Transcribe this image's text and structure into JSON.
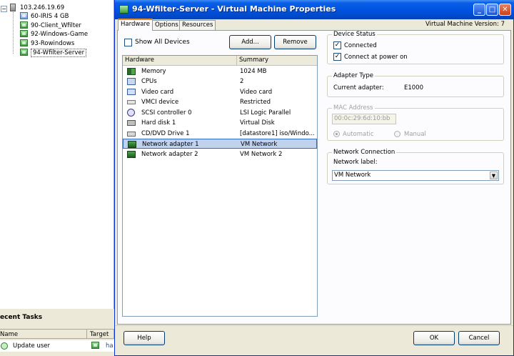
{
  "inventory": {
    "host": "103.246.19.69",
    "vms": [
      {
        "name": "60-IRIS 4 GB",
        "powered": false
      },
      {
        "name": "90-Client_Wfilter",
        "powered": true
      },
      {
        "name": "92-Windows-Game",
        "powered": true
      },
      {
        "name": "93-Rowindows",
        "powered": true
      },
      {
        "name": "94-Wfilter-Server",
        "powered": true,
        "selected": true
      }
    ]
  },
  "recent_tasks": {
    "title": "ecent Tasks",
    "columns": [
      "Name",
      "Target"
    ],
    "rows": [
      {
        "name": "Update user",
        "target": "ha"
      }
    ]
  },
  "dialog": {
    "title": "94-Wfilter-Server - Virtual Machine Properties",
    "window_buttons": {
      "minimize": "_",
      "maximize": "□",
      "close": "✕"
    },
    "tabs": [
      "Hardware",
      "Options",
      "Resources"
    ],
    "active_tab": "Hardware",
    "vm_version": "Virtual Machine Version: 7",
    "show_all_devices": {
      "label": "Show All Devices",
      "checked": false
    },
    "add_button": "Add...",
    "remove_button": "Remove",
    "hardware_list": {
      "columns": [
        "Hardware",
        "Summary"
      ],
      "rows": [
        {
          "name": "Memory",
          "summary": "1024 MB",
          "icon": "memory-icon"
        },
        {
          "name": "CPUs",
          "summary": "2",
          "icon": "cpu-icon"
        },
        {
          "name": "Video card",
          "summary": "Video card",
          "icon": "video-card-icon"
        },
        {
          "name": "VMCI device",
          "summary": "Restricted",
          "icon": "vmci-icon"
        },
        {
          "name": "SCSI controller 0",
          "summary": "LSI Logic Parallel",
          "icon": "scsi-controller-icon"
        },
        {
          "name": "Hard disk 1",
          "summary": "Virtual Disk",
          "icon": "hard-disk-icon"
        },
        {
          "name": "CD/DVD Drive 1",
          "summary": "[datastore1] iso/Windo...",
          "icon": "cd-dvd-icon"
        },
        {
          "name": "Network adapter 1",
          "summary": "VM Network",
          "icon": "network-adapter-icon",
          "selected": true
        },
        {
          "name": "Network adapter 2",
          "summary": "VM Network 2",
          "icon": "network-adapter-icon"
        }
      ]
    },
    "device_status": {
      "title": "Device Status",
      "connected": {
        "label": "Connected",
        "checked": true
      },
      "connect_at_power_on": {
        "label": "Connect at power on",
        "checked": true
      }
    },
    "adapter_type": {
      "title": "Adapter Type",
      "label": "Current adapter:",
      "value": "E1000"
    },
    "mac_address": {
      "title": "MAC Address",
      "value": "00:0c:29:6d:10:bb",
      "automatic": "Automatic",
      "manual": "Manual",
      "selected": "Automatic"
    },
    "network_connection": {
      "title": "Network Connection",
      "label": "Network label:",
      "value": "VM Network"
    },
    "help_button": "Help",
    "ok_button": "OK",
    "cancel_button": "Cancel"
  },
  "colors": {
    "titlebar": "#0054e3",
    "selection": "#c1d2ee",
    "dialog_background": "#ece9d8"
  }
}
